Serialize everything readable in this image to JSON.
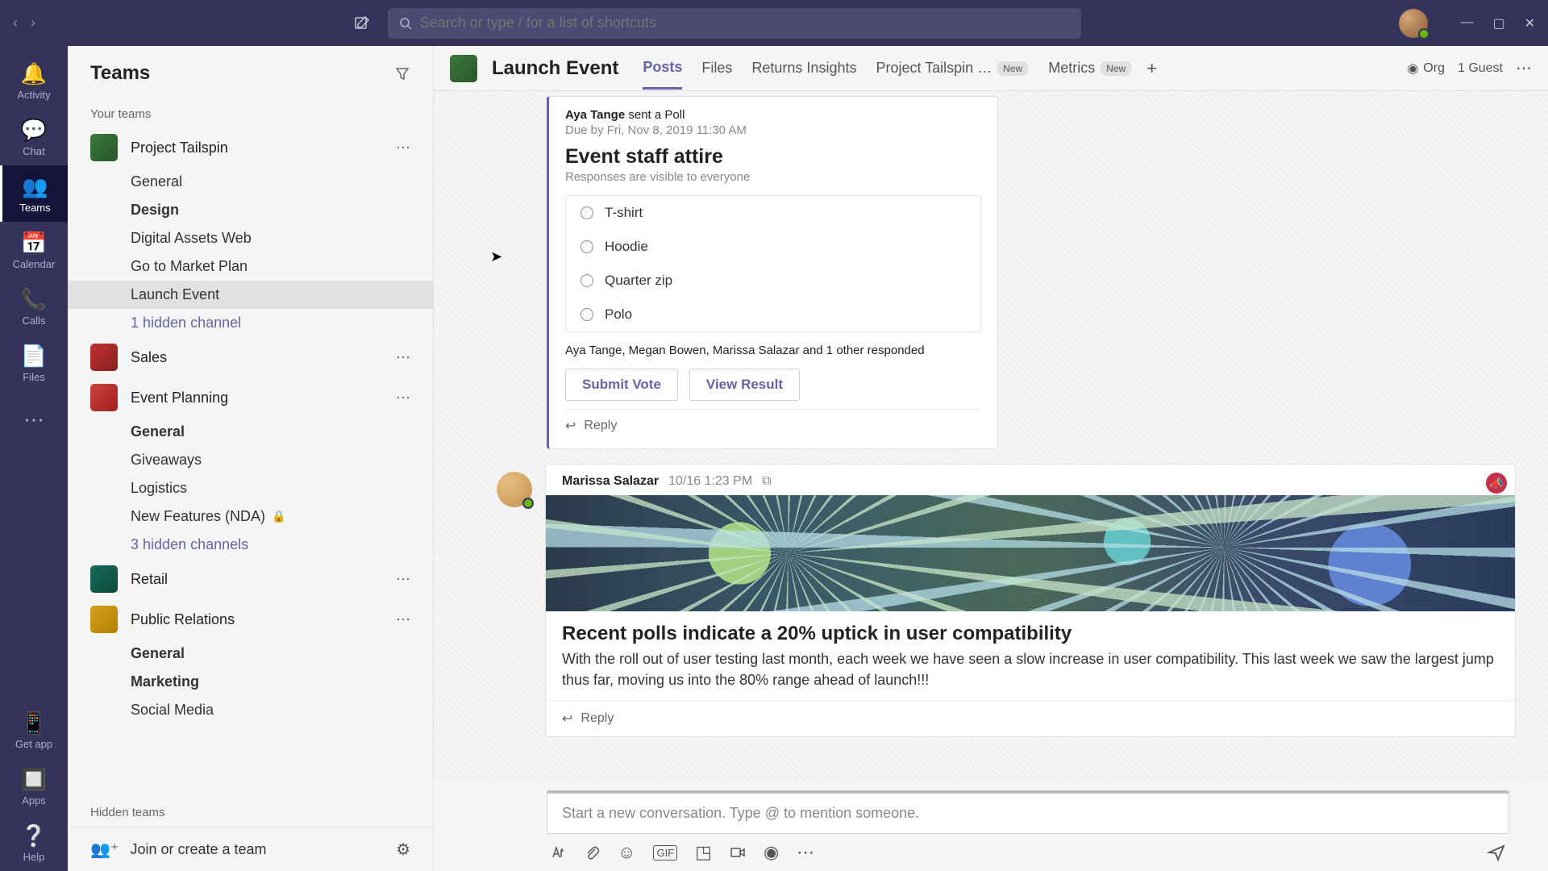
{
  "search": {
    "placeholder": "Search or type / for a list of shortcuts"
  },
  "rail": [
    {
      "icon": "🔔",
      "label": "Activity"
    },
    {
      "icon": "💬",
      "label": "Chat"
    },
    {
      "icon": "👥",
      "label": "Teams"
    },
    {
      "icon": "📅",
      "label": "Calendar"
    },
    {
      "icon": "📞",
      "label": "Calls"
    },
    {
      "icon": "📄",
      "label": "Files"
    },
    {
      "icon": "⋯",
      "label": ""
    }
  ],
  "rail_bottom": [
    {
      "icon": "📱",
      "label": "Get app"
    },
    {
      "icon": "🔲",
      "label": "Apps"
    },
    {
      "icon": "❔",
      "label": "Help"
    }
  ],
  "sidebar": {
    "title": "Teams",
    "section_label": "Your teams",
    "teams": [
      {
        "name": "Project Tailspin",
        "channels": [
          {
            "label": "General"
          },
          {
            "label": "Design",
            "bold": true
          },
          {
            "label": "Digital Assets Web"
          },
          {
            "label": "Go to Market Plan"
          },
          {
            "label": "Launch Event",
            "active": true
          },
          {
            "label": "1 hidden channel",
            "link": true
          }
        ]
      },
      {
        "name": "Sales",
        "channels": []
      },
      {
        "name": "Event Planning",
        "channels": [
          {
            "label": "General",
            "bold": true
          },
          {
            "label": "Giveaways"
          },
          {
            "label": "Logistics"
          },
          {
            "label": "New Features (NDA)",
            "lock": true
          },
          {
            "label": "3 hidden channels",
            "link": true
          }
        ]
      },
      {
        "name": "Retail",
        "channels": []
      },
      {
        "name": "Public Relations",
        "channels": [
          {
            "label": "General",
            "bold": true
          },
          {
            "label": "Marketing",
            "bold": true
          },
          {
            "label": "Social Media"
          }
        ]
      }
    ],
    "hidden_teams": "Hidden teams",
    "join_create": "Join or create a team"
  },
  "header": {
    "channel": "Launch Event",
    "tabs": [
      {
        "label": "Posts",
        "active": true
      },
      {
        "label": "Files"
      },
      {
        "label": "Returns Insights"
      },
      {
        "label": "Project Tailspin …",
        "new": true
      },
      {
        "label": "Metrics",
        "new": true
      }
    ],
    "org": "Org",
    "guest": "1 Guest",
    "new_badge": "New"
  },
  "poll": {
    "sender_name": "Aya Tange",
    "sender_action": " sent a Poll",
    "due": "Due by Fri, Nov 8, 2019 11:30 AM",
    "title": "Event staff attire",
    "subtitle": "Responses are visible to everyone",
    "options": [
      "T-shirt",
      "Hoodie",
      "Quarter zip",
      "Polo"
    ],
    "responders": "Aya Tange, Megan Bowen, Marissa Salazar and 1 other responded",
    "submit": "Submit Vote",
    "view": "View Result",
    "reply": "Reply"
  },
  "message": {
    "author": "Marissa Salazar",
    "time": "10/16 1:23 PM",
    "title": "Recent polls indicate a 20% uptick in user compatibility",
    "body": "With the roll out of user testing last month, each week we have seen a slow increase in user compatibility.  This last week we saw the largest jump thus far, moving us into the 80% range ahead of launch!!!",
    "reply": "Reply"
  },
  "compose": {
    "placeholder": "Start a new conversation. Type @ to mention someone."
  }
}
